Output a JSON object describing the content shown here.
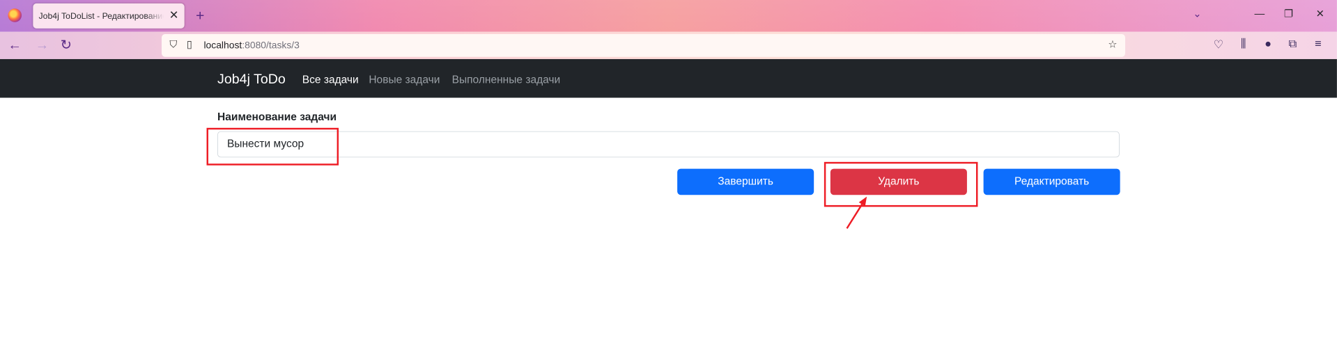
{
  "browser": {
    "tab_title": "Job4j ToDoList - Редактирование за",
    "url_host": "localhost",
    "url_path": ":8080/tasks/3",
    "icons": {
      "logo": "firefox-icon",
      "close_tab": "close-icon",
      "new_tab": "plus-icon",
      "list_tabs": "chevron-down-icon",
      "back": "back-arrow-icon",
      "forward": "forward-arrow-icon",
      "reload": "reload-icon",
      "shield": "shield-icon",
      "page": "page-icon",
      "bookmark": "star-icon",
      "pocket": "pocket-icon",
      "library": "library-icon",
      "account": "account-icon",
      "extensions": "puzzle-icon",
      "menu": "hamburger-icon",
      "minimize": "minimize-icon",
      "restore": "restore-icon",
      "close_window": "close-icon"
    }
  },
  "site": {
    "brand": "Job4j ToDo",
    "nav": [
      {
        "label": "Все задачи",
        "active": true
      },
      {
        "label": "Новые задачи",
        "active": false
      },
      {
        "label": "Выполненные задачи",
        "active": false
      }
    ]
  },
  "form": {
    "label": "Наименование задачи",
    "task_name_value": "Вынести мусор",
    "buttons": {
      "complete": "Завершить",
      "delete": "Удалить",
      "edit": "Редактировать"
    }
  },
  "colors": {
    "navbar": "#212529",
    "primary": "#0d6efd",
    "danger": "#dc3545",
    "annotation": "#ee1c25"
  }
}
